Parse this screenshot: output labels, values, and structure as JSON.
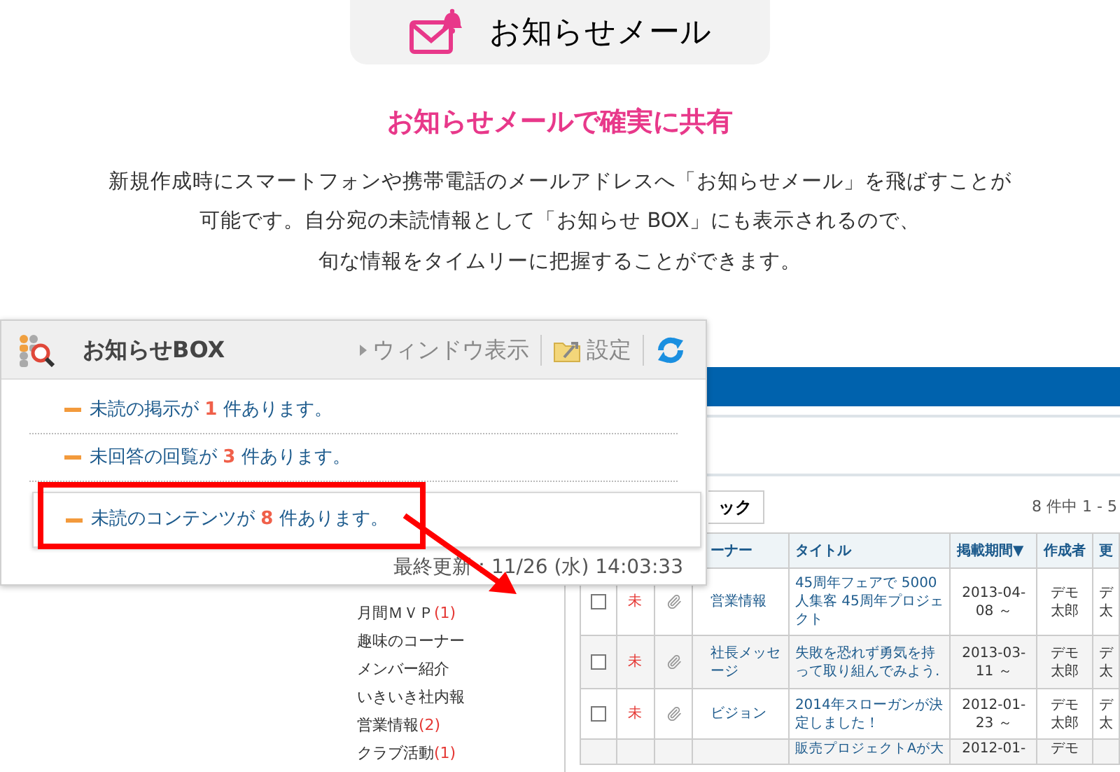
{
  "header": {
    "title": "お知らせメール"
  },
  "headline": "お知らせメールで確実に共有",
  "description": [
    "新規作成時にスマートフォンや携帯電話のメールアドレスへ「お知らせメール」を飛ばすことが",
    "可能です。自分宛の未読情報として「お知らせ BOX」にも表示されるので、",
    "旬な情報をタイムリーに把握することができます。"
  ],
  "app": {
    "search_value": "ック",
    "count": "8 件中 1 - 5",
    "sidebar": [
      {
        "name": "月間ＭＶＰ",
        "count": "(1)"
      },
      {
        "name": "趣味のコーナー"
      },
      {
        "name": "メンバー紹介"
      },
      {
        "name": "いきいき社内報"
      },
      {
        "name": "営業情報",
        "count": "(2)"
      },
      {
        "name": "クラブ活動",
        "count": "(1)"
      }
    ],
    "table": {
      "columns": [
        "ーナー",
        "タイトル",
        "掲載期間▼",
        "作成者",
        "更"
      ],
      "rows": [
        {
          "checked": false,
          "unread": "未",
          "corner": "営業情報",
          "title": "45周年フェアで 5000人集客 45周年プロジェクト",
          "period": "2013-04-08 ～",
          "author": "デモ太郎",
          "column_5": "デ太"
        },
        {
          "checked": false,
          "unread": "未",
          "corner": "社長メッセージ",
          "title": "失敗を恐れず勇気を持って取り組んでみよう.",
          "period": "2013-03-11 ～",
          "author": "デモ太郎",
          "column_5": "デ太"
        },
        {
          "checked": false,
          "unread": "未",
          "corner": "ビジョン",
          "title": "2014年スローガンが決定しました！",
          "period": "2012-01-23 ～",
          "author": "デモ太郎",
          "column_5": "デ太"
        },
        {
          "unread": "",
          "corner": "",
          "title": "販売プロジェクトAが大",
          "period": "2012-01-",
          "author": "デモ",
          "column_5": ""
        }
      ]
    }
  },
  "popup": {
    "title": "お知らせBOX",
    "window_link": "ウィンドウ表示",
    "settings": "設定",
    "items": [
      {
        "before": "未読の掲示が",
        "count": "1",
        "after": "件あります。",
        "highlighted": false
      },
      {
        "before": "未回答の回覧が",
        "count": "3",
        "after": "件あります。",
        "highlighted": false
      },
      {
        "before": "未読のコンテンツが",
        "count": "8",
        "after": "件あります。",
        "highlighted": true
      }
    ],
    "last_updated": "最終更新：11/26 (水) 14:03:33"
  }
}
